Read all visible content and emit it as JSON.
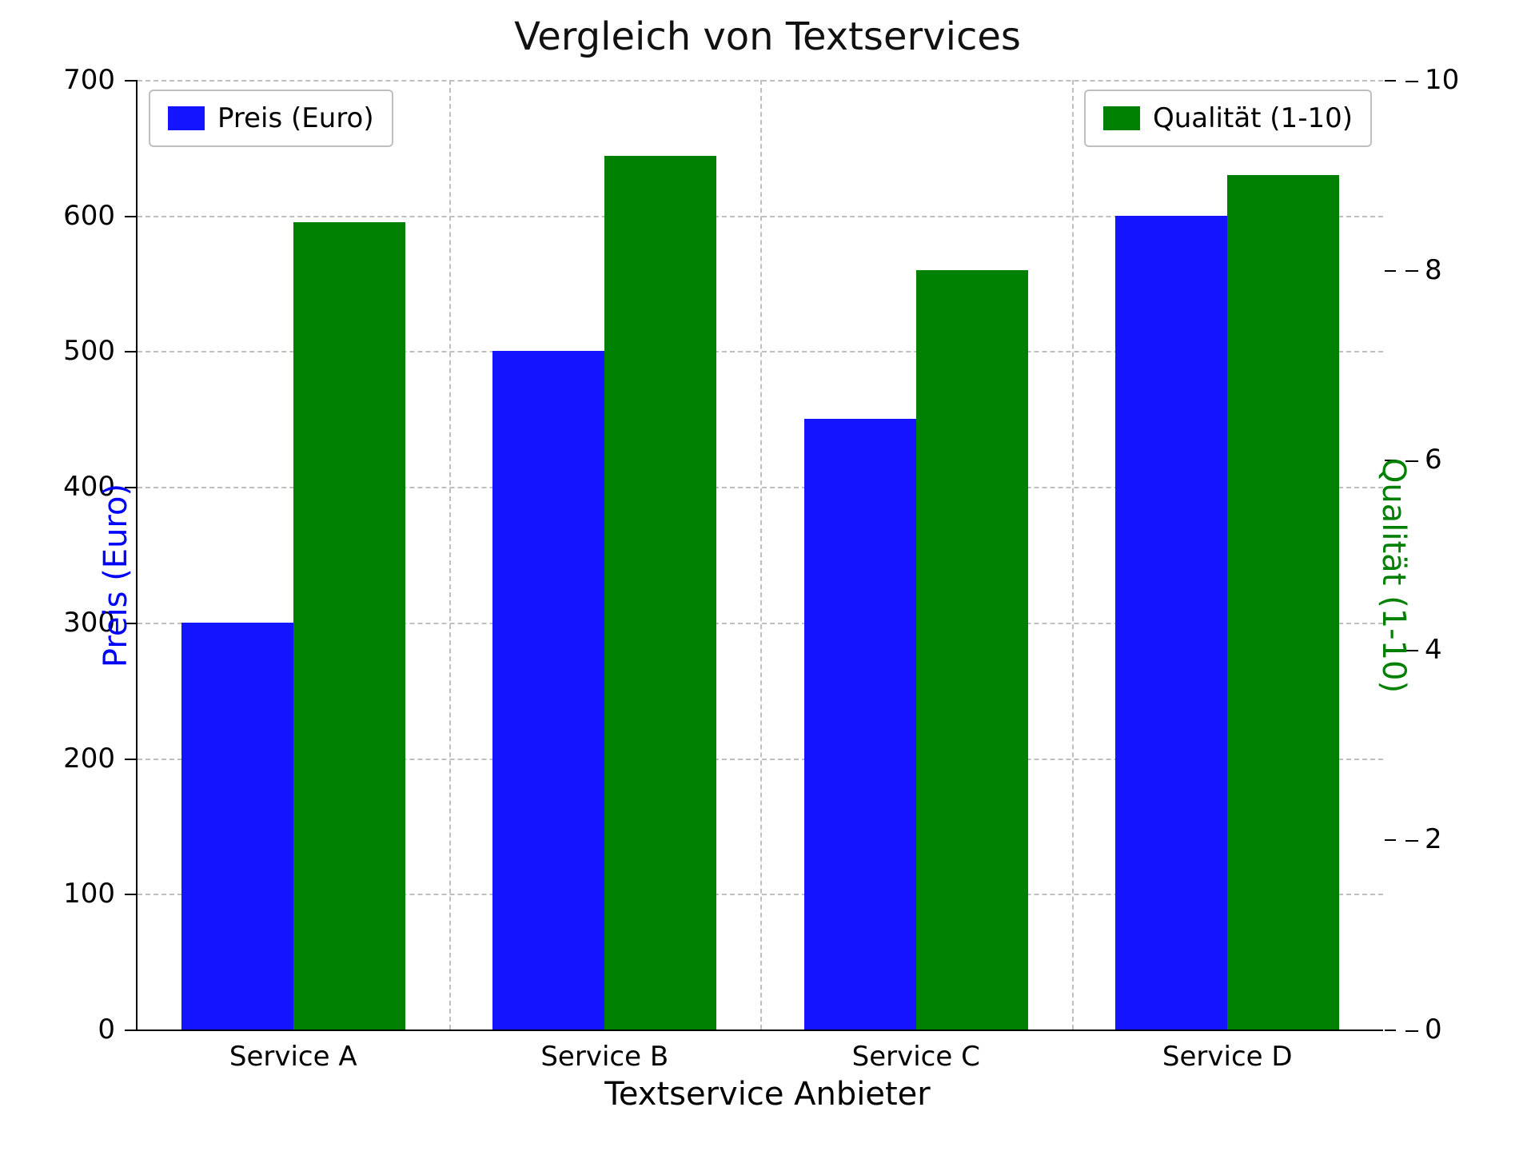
{
  "chart_data": {
    "type": "bar",
    "title": "Vergleich von Textservices",
    "xlabel": "Textservice Anbieter",
    "categories": [
      "Service A",
      "Service B",
      "Service C",
      "Service D"
    ],
    "series": [
      {
        "name": "Preis (Euro)",
        "values": [
          300,
          500,
          450,
          600
        ],
        "axis": "left",
        "color": "#1414ff"
      },
      {
        "name": "Qualität (1-10)",
        "values": [
          8.5,
          9.2,
          8.0,
          9.0
        ],
        "axis": "right",
        "color": "#008000"
      }
    ],
    "left_axis": {
      "label": "Preis (Euro)",
      "min": 0,
      "max": 700,
      "ticks": [
        0,
        100,
        200,
        300,
        400,
        500,
        600,
        700
      ],
      "color": "#0000ff"
    },
    "right_axis": {
      "label": "Qualität (1-10)",
      "min": 0,
      "max": 10,
      "ticks": [
        0,
        2,
        4,
        6,
        8,
        10
      ],
      "color": "#008000"
    },
    "legend": [
      {
        "name": "Preis (Euro)",
        "color": "#1414ff",
        "position": "upper-left"
      },
      {
        "name": "Qualität (1-10)",
        "color": "#008000",
        "position": "upper-right"
      }
    ],
    "grid": true
  }
}
